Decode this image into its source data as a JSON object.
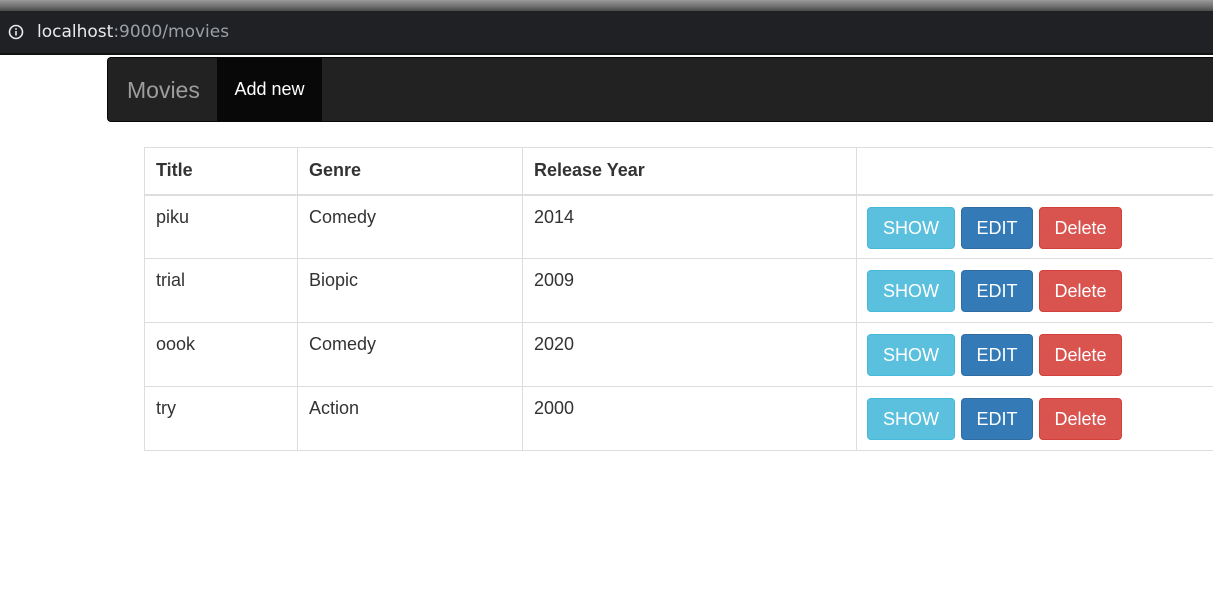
{
  "browser": {
    "url_host": "localhost",
    "url_rest": ":9000/movies"
  },
  "navbar": {
    "brand": "Movies",
    "add_new": "Add new"
  },
  "table": {
    "headers": {
      "title": "Title",
      "genre": "Genre",
      "release_year": "Release Year",
      "actions": ""
    },
    "rows": [
      {
        "title": "piku",
        "genre": "Comedy",
        "year": "2014"
      },
      {
        "title": "trial",
        "genre": "Biopic",
        "year": "2009"
      },
      {
        "title": "oook",
        "genre": "Comedy",
        "year": "2020"
      },
      {
        "title": "try",
        "genre": "Action",
        "year": "2000"
      }
    ],
    "buttons": {
      "show": "SHOW",
      "edit": "EDIT",
      "delete": "Delete"
    }
  },
  "colors": {
    "navbar_bg": "#222222",
    "show": "#5bc0de",
    "edit": "#337ab7",
    "delete": "#d9534f"
  },
  "icons": {
    "address_info": "info-icon"
  }
}
